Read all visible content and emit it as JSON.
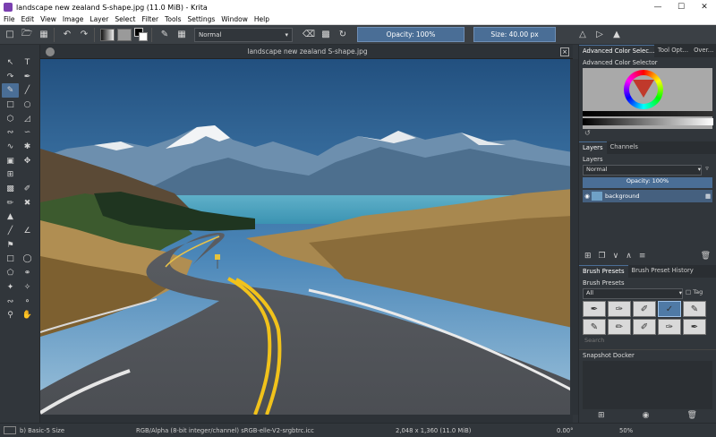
{
  "window": {
    "title": "landscape new zealand S-shape.jpg (11.0 MiB) - Krita"
  },
  "menu": [
    "File",
    "Edit",
    "View",
    "Image",
    "Layer",
    "Select",
    "Filter",
    "Tools",
    "Settings",
    "Window",
    "Help"
  ],
  "toolbar": {
    "blend_mode": "Normal",
    "opacity": "Opacity: 100%",
    "size": "Size: 40.00 px"
  },
  "document": {
    "tab_title": "landscape new zealand S-shape.jpg"
  },
  "right_panel": {
    "top_tabs": [
      "Advanced Color Selec...",
      "Tool Opt...",
      "Over..."
    ],
    "color_selector_title": "Advanced Color Selector",
    "layer_tabs": [
      "Layers",
      "Channels"
    ],
    "layers_title": "Layers",
    "layer_blend": "Normal",
    "layer_opacity": "Opacity: 100%",
    "layers": [
      {
        "name": "background"
      }
    ],
    "brush_tabs": [
      "Brush Presets",
      "Brush Preset History"
    ],
    "brush_title": "Brush Presets",
    "brush_filter": "All",
    "brush_tag": "Tag",
    "search_placeholder": "Search",
    "snapshot_title": "Snapshot Docker"
  },
  "status": {
    "brush": "b) Basic-5 Size",
    "colorspace": "RGB/Alpha (8-bit integer/channel)  sRGB-elle-V2-srgbtrc.icc",
    "dimensions": "2,048 x 1,360 (11.0 MiB)",
    "rotation": "0.00°",
    "zoom": "50%"
  },
  "colors": {
    "accent": "#4a6e96",
    "panel": "#31363b"
  }
}
